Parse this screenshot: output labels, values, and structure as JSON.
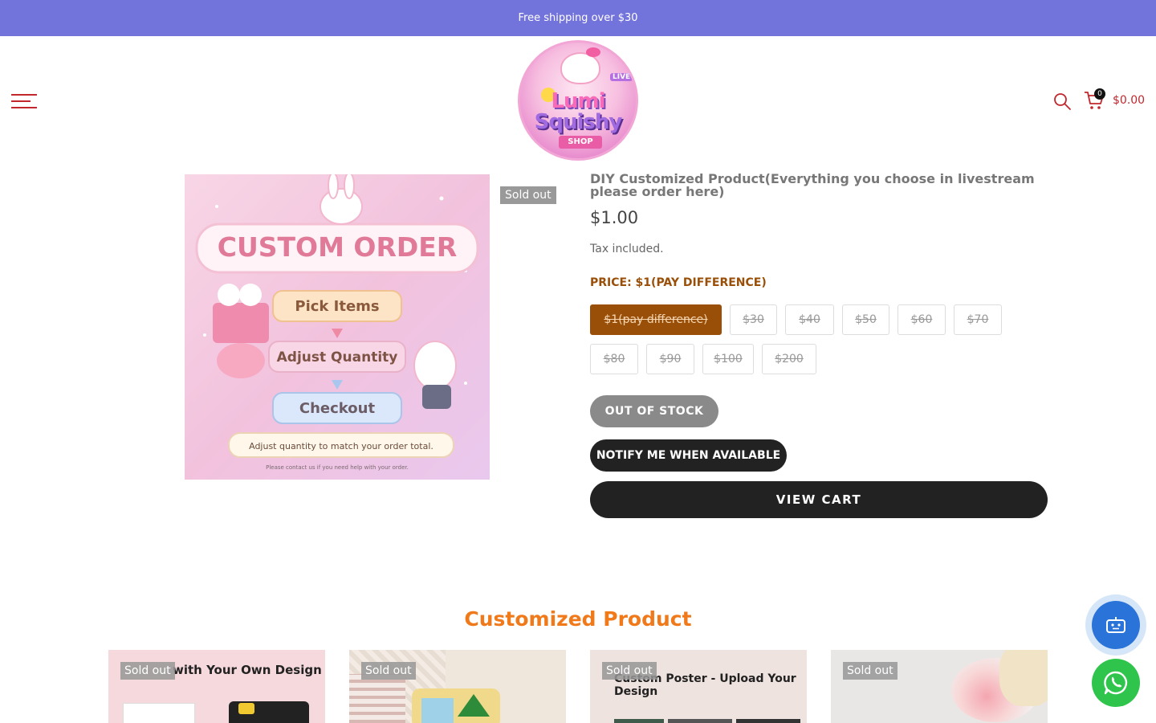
{
  "announcement": "Free shipping over $30",
  "header": {
    "logo": {
      "line1": "Lumi",
      "line2": "Squishy",
      "ribbon": "SHOP",
      "badge": "LIVE"
    },
    "cart_count": "0",
    "cart_total": "$0.00"
  },
  "product": {
    "sold_out_label": "Sold out",
    "image_text": {
      "headline": "CUSTOM ORDER",
      "step1": "Pick Items",
      "step2": "Adjust Quantity",
      "step3": "Checkout",
      "note": "Adjust quantity to match your order total.",
      "footnote": "Please contact us if you need help with your order."
    },
    "title": "DIY Customized Product(Everything you choose in livestream please order here)",
    "price": "$1.00",
    "tax_note": "Tax included.",
    "option_label": "PRICE: $1(PAY DIFFERENCE)",
    "options": [
      "$1(pay difference)",
      "$30",
      "$40",
      "$50",
      "$60",
      "$70",
      "$80",
      "$90",
      "$100",
      "$200"
    ],
    "selected_option": "$1(pay difference)",
    "out_of_stock_label": "OUT OF STOCK",
    "notify_label": "NOTIFY ME WHEN AVAILABLE",
    "view_cart_label": "VIEW CART"
  },
  "related": {
    "title": "Customized Product",
    "cards": [
      {
        "badge": "Sold out",
        "caption": "with Your Own Design"
      },
      {
        "badge": "Sold out",
        "caption": ""
      },
      {
        "badge": "Sold out",
        "caption": "Custom Poster - Upload Your Design"
      },
      {
        "badge": "Sold out",
        "caption": ""
      }
    ]
  },
  "colors": {
    "announcement_bg": "#7373dc",
    "accent_red": "#c1272d",
    "option_active": "#9a4f08",
    "section_title": "#f07a1a",
    "chat_blue": "#2a73d9",
    "whatsapp_green": "#2fc44b"
  },
  "icons": [
    "menu-icon",
    "search-icon",
    "cart-icon",
    "chat-bot-icon",
    "whatsapp-icon"
  ]
}
